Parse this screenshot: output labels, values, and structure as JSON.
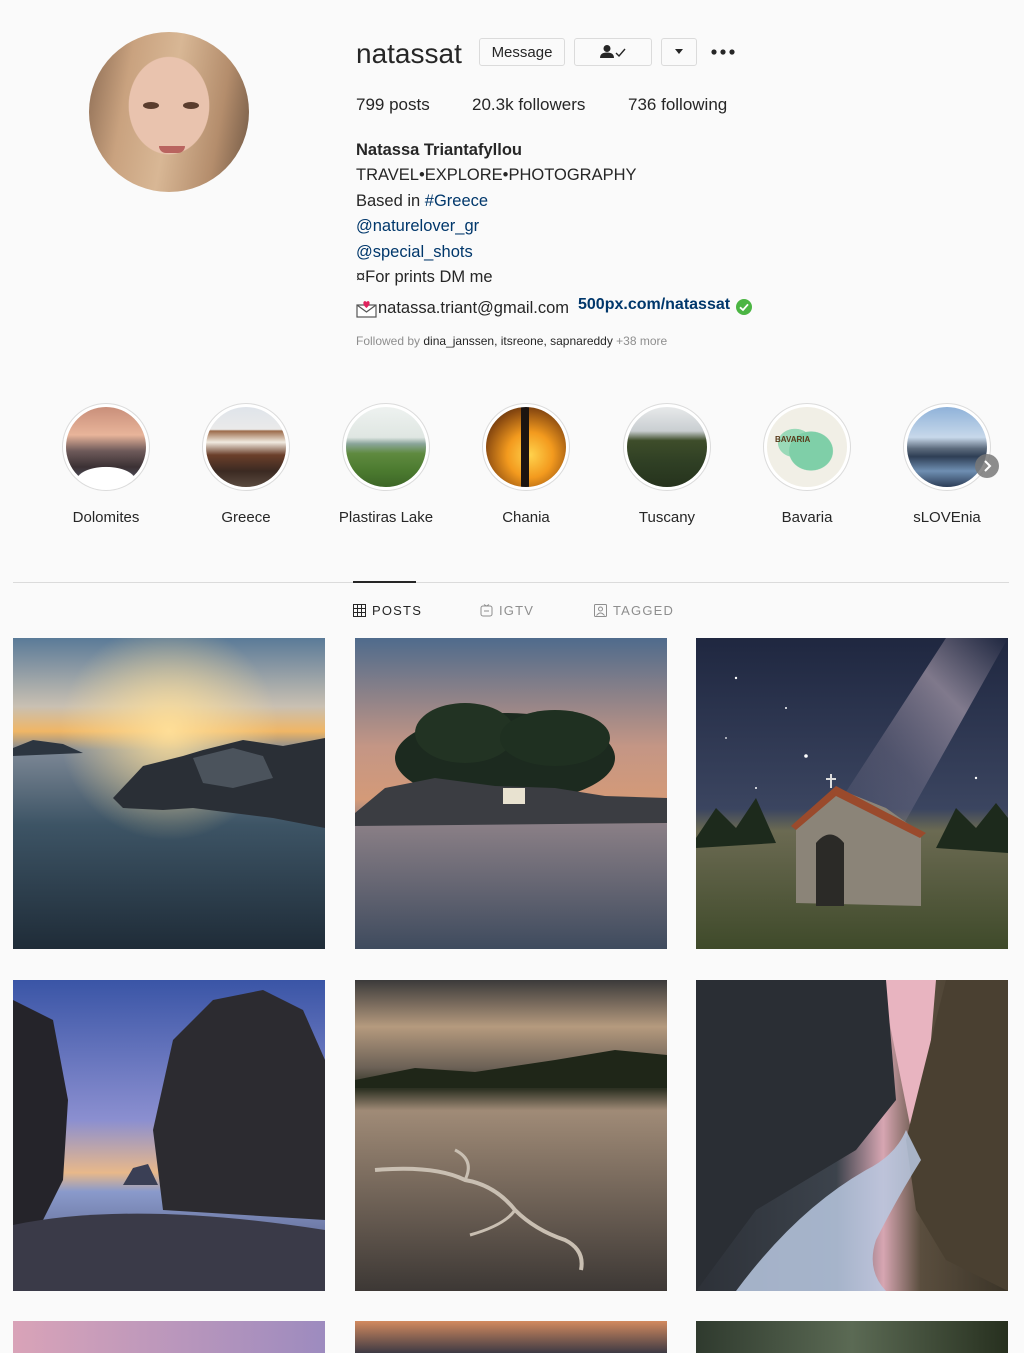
{
  "profile": {
    "username": "natassat",
    "message_label": "Message",
    "posts_count": "799",
    "posts_label": " posts",
    "followers_count": "20.3k",
    "followers_label": " followers",
    "following_count": "736",
    "following_label": " following",
    "full_name": "Natassa Triantafyllou",
    "bio_line1": "TRAVEL•EXPLORE•PHOTOGRAPHY",
    "bio_based_prefix": "Based in ",
    "bio_hashtag": "#Greece",
    "bio_mention1": "@naturelover_gr",
    "bio_mention2": "@special_shots",
    "bio_prints": "¤For prints DM me",
    "bio_email": "natassa.triant@gmail.com",
    "website": "500px.com/natassat",
    "followed_prefix": "Followed by ",
    "followed_names": "dina_janssen, itsreone, sapnareddy",
    "followed_more": " +38 more"
  },
  "highlights": [
    {
      "label": "Dolomites"
    },
    {
      "label": "Greece"
    },
    {
      "label": "Plastiras Lake"
    },
    {
      "label": "Chania"
    },
    {
      "label": "Tuscany"
    },
    {
      "label": "Bavaria"
    },
    {
      "label": "sLOVEnia"
    }
  ],
  "bavaria_map_text": "BAVARIA",
  "tabs": [
    {
      "label": "POSTS",
      "icon": "grid-icon",
      "active": true
    },
    {
      "label": "IGTV",
      "icon": "igtv-icon",
      "active": false
    },
    {
      "label": "TAGGED",
      "icon": "tagged-icon",
      "active": false
    }
  ],
  "colors": {
    "link": "#00376b",
    "border": "#dbdbdb",
    "muted": "#8e8e8e",
    "verified": "#4bb543"
  }
}
